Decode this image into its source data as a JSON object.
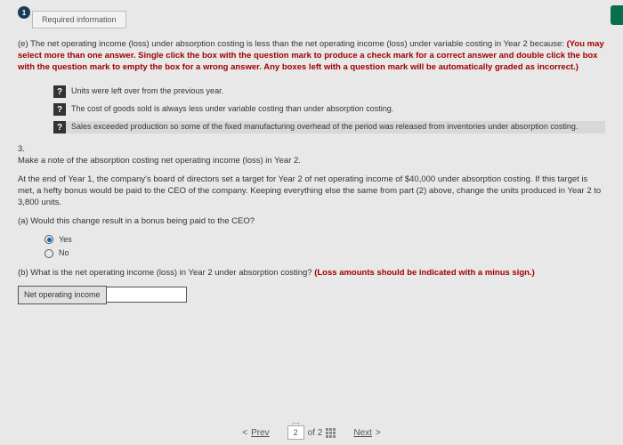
{
  "header": {
    "badge_num": "1",
    "tab_label": "Required information"
  },
  "question_e": {
    "prefix": "(e) The net operating income (loss) under absorption costing is less than the net operating income (loss) under variable costing in Year 2 because: ",
    "instructions": "(You may select more than one answer. Single click the box with the question mark to produce a check mark for a correct answer and double click the box with the question mark to empty the box for a wrong answer. Any boxes left with a question mark will be automatically graded as incorrect.)"
  },
  "options": [
    {
      "text": "Units were left over from the previous year."
    },
    {
      "text": "The cost of goods sold is always less under variable costing than under absorption costing."
    },
    {
      "text": "Sales exceeded production so some of the fixed manufacturing overhead of the period was released from inventories under absorption costing."
    }
  ],
  "section3": {
    "num": "3.",
    "note": "Make a note of the absorption costing net operating income (loss) in Year 2.",
    "scenario": "At the end of Year 1, the company's board of directors set a target for Year 2 of net operating income of $40,000 under absorption costing. If this target is met, a hefty bonus would be paid to the CEO of the company. Keeping everything else the same from part (2) above, change the units produced in Year 2 to 3,800 units.",
    "qa": "(a) Would this change result in a bonus being paid to the CEO?",
    "radio_yes": "Yes",
    "radio_no": "No",
    "qb_prefix": "(b) What is the net operating income (loss) in Year 2 under absorption costing? ",
    "qb_instr": "(Loss amounts should be indicated with a minus sign.)",
    "input_label": "Net operating income"
  },
  "nav": {
    "prev": "Prev",
    "page_current": "2",
    "page_of": "of 2",
    "next": "Next"
  }
}
